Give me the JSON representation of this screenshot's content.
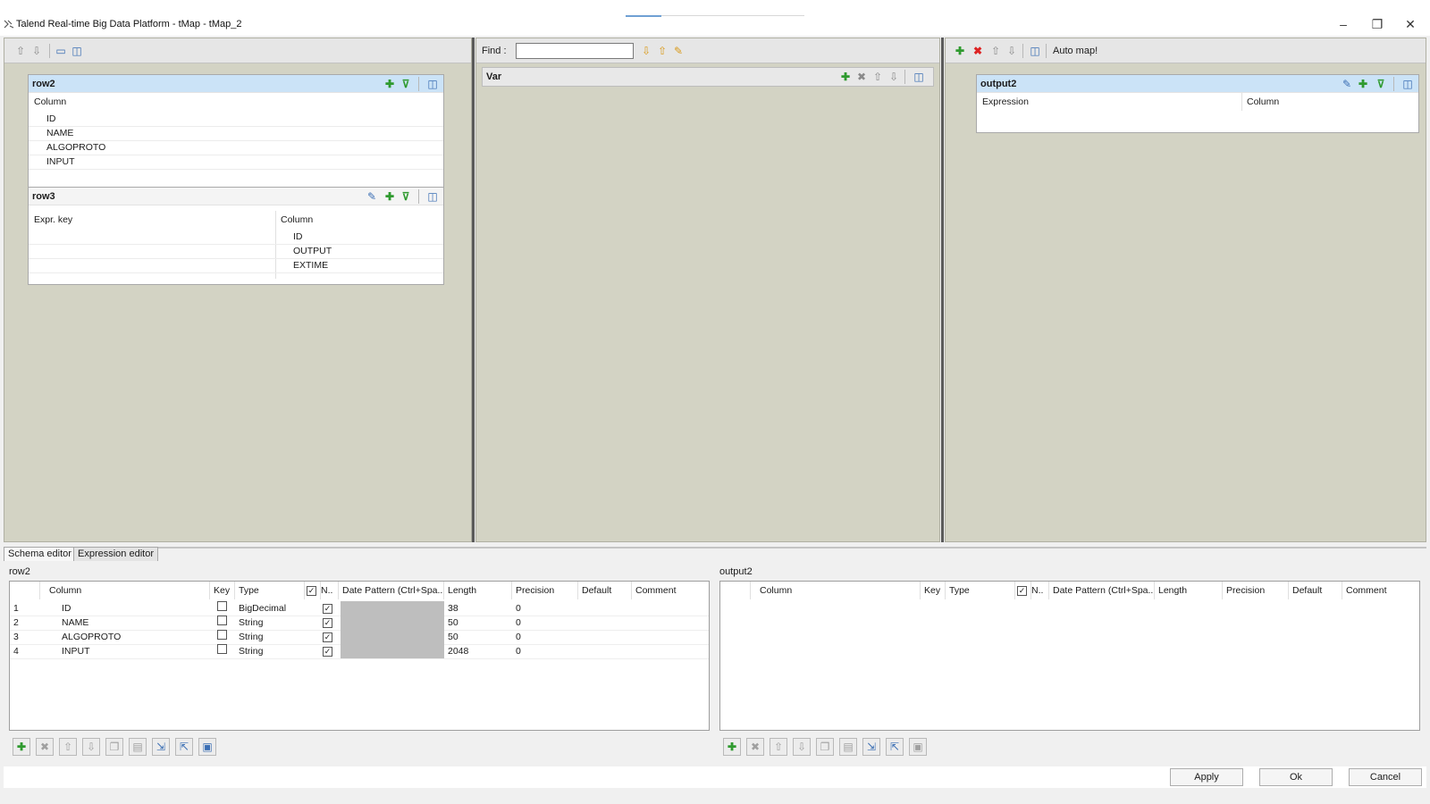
{
  "window": {
    "title": "Talend Real-time Big Data Platform - tMap - tMap_2",
    "minimize": "–",
    "restore": "❐",
    "close": "✕"
  },
  "input_panel": {
    "tables": [
      {
        "name": "row2",
        "header": "Column",
        "rows": [
          "ID",
          "NAME",
          "ALGOPROTO",
          "INPUT"
        ]
      },
      {
        "name": "row3",
        "expr_header": "Expr. key",
        "col_header": "Column",
        "rows": [
          "ID",
          "OUTPUT",
          "EXTIME"
        ]
      }
    ]
  },
  "var_panel": {
    "find_label": "Find :",
    "find_value": "",
    "title": "Var"
  },
  "output_panel": {
    "auto_map_label": "Auto map!",
    "table": {
      "name": "output2",
      "expr_header": "Expression",
      "col_header": "Column"
    }
  },
  "bottom": {
    "tabs": [
      "Schema editor",
      "Expression editor"
    ],
    "left": {
      "title": "row2",
      "headers": [
        "Column",
        "Key",
        "Type",
        "N..",
        "Date Pattern (Ctrl+Spa...",
        "Length",
        "Precision",
        "Default",
        "Comment"
      ],
      "rows": [
        {
          "n": "1",
          "column": "ID",
          "type": "BigDecimal",
          "length": "38",
          "precision": "0"
        },
        {
          "n": "2",
          "column": "NAME",
          "type": "String",
          "length": "50",
          "precision": "0"
        },
        {
          "n": "3",
          "column": "ALGOPROTO",
          "type": "String",
          "length": "50",
          "precision": "0"
        },
        {
          "n": "4",
          "column": "INPUT",
          "type": "String",
          "length": "2048",
          "precision": "0"
        }
      ]
    },
    "right": {
      "title": "output2",
      "headers": [
        "Column",
        "Key",
        "Type",
        "N..",
        "Date Pattern (Ctrl+Spa...",
        "Length",
        "Precision",
        "Default",
        "Comment"
      ]
    }
  },
  "buttons": {
    "apply": "Apply",
    "ok": "Ok",
    "cancel": "Cancel"
  },
  "colors": {
    "panel_bg": "#d3d3c4",
    "table_header_selected": "#cbe3f7",
    "add_green": "#2f9a2f",
    "remove_red": "#dd2222"
  }
}
